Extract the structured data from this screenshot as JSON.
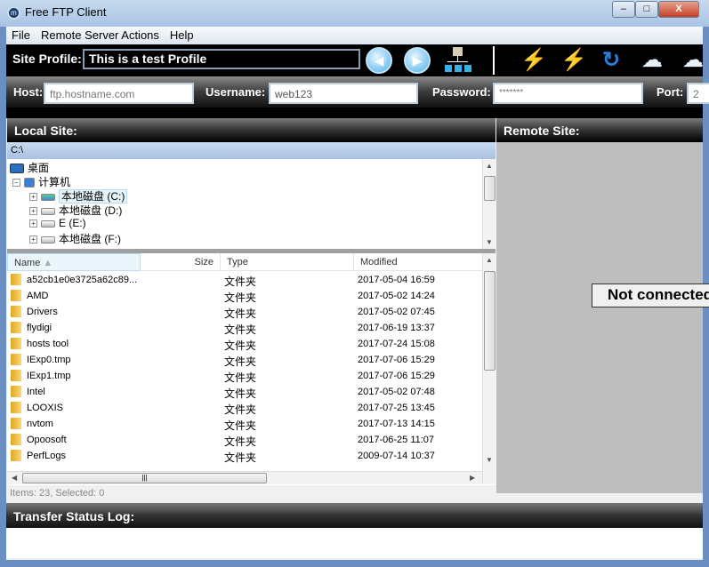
{
  "window": {
    "title": "Free FTP Client",
    "min": "–",
    "max": "□",
    "close": "X"
  },
  "menu": [
    "File",
    "Remote Server Actions",
    "Help"
  ],
  "toolbar": {
    "site_profile_label": "Site Profile:",
    "site_profile_value": "This is a test Profile",
    "icons": [
      "back-icon",
      "forward-icon",
      "sitemap-icon",
      "connect-icon",
      "disconnect-icon",
      "refresh-icon",
      "upload-icon",
      "download-icon"
    ]
  },
  "connection": {
    "host_label": "Host:",
    "host_placeholder": "ftp.hostname.com",
    "username_label": "Username:",
    "username_value": "web123",
    "password_label": "Password:",
    "password_value": "*******",
    "port_label": "Port:",
    "port_value": "2"
  },
  "local": {
    "title": "Local Site:",
    "path": "C:\\",
    "tree": [
      {
        "label": "桌面"
      },
      {
        "label": "计算机"
      },
      {
        "label": "本地磁盘 (C:)"
      },
      {
        "label": "本地磁盘 (D:)"
      },
      {
        "label": "E (E:)"
      },
      {
        "label": "本地磁盘 (F:)"
      }
    ],
    "columns": {
      "name": "Name",
      "size": "Size",
      "type": "Type",
      "modified": "Modified"
    },
    "files": [
      {
        "name": "a52cb1e0e3725a62c89...",
        "type": "文件夹",
        "modified": "2017-05-04 16:59"
      },
      {
        "name": "AMD",
        "type": "文件夹",
        "modified": "2017-05-02 14:24"
      },
      {
        "name": "Drivers",
        "type": "文件夹",
        "modified": "2017-05-02 07:45"
      },
      {
        "name": "flydigi",
        "type": "文件夹",
        "modified": "2017-06-19 13:37"
      },
      {
        "name": "hosts tool",
        "type": "文件夹",
        "modified": "2017-07-24 15:08"
      },
      {
        "name": "IExp0.tmp",
        "type": "文件夹",
        "modified": "2017-07-06 15:29"
      },
      {
        "name": "IExp1.tmp",
        "type": "文件夹",
        "modified": "2017-07-06 15:29"
      },
      {
        "name": "Intel",
        "type": "文件夹",
        "modified": "2017-05-02 07:48"
      },
      {
        "name": "LOOXIS",
        "type": "文件夹",
        "modified": "2017-07-25 13:45"
      },
      {
        "name": "nvtom",
        "type": "文件夹",
        "modified": "2017-07-13 14:15"
      },
      {
        "name": "Opoosoft",
        "type": "文件夹",
        "modified": "2017-06-25 11:07"
      },
      {
        "name": "PerfLogs",
        "type": "文件夹",
        "modified": "2009-07-14 10:37"
      }
    ],
    "status": "Items: 23, Selected: 0"
  },
  "remote": {
    "title": "Remote Site:",
    "state": "Not connected"
  },
  "transfer": {
    "title": "Transfer Status Log:"
  }
}
